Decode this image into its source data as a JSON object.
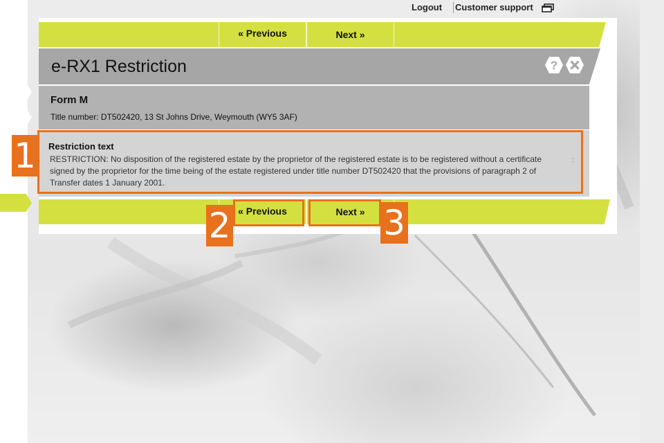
{
  "header": {
    "logout_label": "Logout",
    "support_label": "Customer support",
    "support_icon": "window-icon"
  },
  "nav_top": {
    "previous_label": "« Previous",
    "next_label": "Next »"
  },
  "nav_bottom": {
    "previous_label": "« Previous",
    "next_label": "Next »"
  },
  "page": {
    "title": "e-RX1 Restriction",
    "icons": [
      "help-icon",
      "close-icon"
    ]
  },
  "form": {
    "title": "Form M",
    "title_number": "Title number: DT502420, 13 St Johns Drive, Weymouth (WY5 3AF)"
  },
  "restriction": {
    "heading": "Restriction text",
    "body": "RESTRICTION: No disposition of the registered estate by the proprietor of the registered estate is to be registered without a certificate signed by the proprietor for the time being of the estate registered under title number DT502420 that the provisions of paragraph 2 of Transfer dates 1 January 2001.",
    "marker": ":"
  },
  "callouts": {
    "one": "1",
    "two": "2",
    "three": "3"
  },
  "colors": {
    "accent_green": "#d4e03f",
    "callout_orange": "#e8711d",
    "title_grey": "#a6a6a6",
    "form_grey": "#b2b2b2",
    "restriction_grey": "#d4d4d4"
  }
}
